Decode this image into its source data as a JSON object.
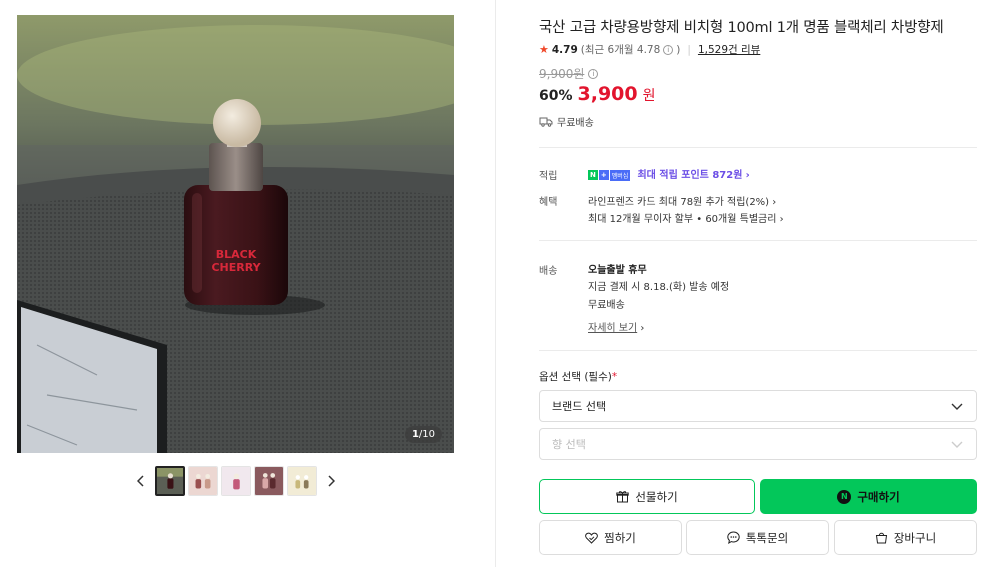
{
  "gallery": {
    "counter_current": "1",
    "counter_total": "/10",
    "prev_arrow": "‹",
    "next_arrow": "›",
    "thumbnails": [
      "thumb-1",
      "thumb-2",
      "thumb-3",
      "thumb-4",
      "thumb-5"
    ],
    "bottle_label_line1": "BLACK",
    "bottle_label_line2": "CHERRY"
  },
  "product": {
    "title": "국산 고급 차량용방향제 비치형 100ml 1개 명품 블랙체리 차방향제",
    "rating": {
      "star": "★",
      "score": "4.79",
      "recent_prefix": "(최근 6개월 4.78",
      "recent_suffix": ")",
      "reviews": "1,529건 리뷰"
    },
    "original_price": "9,900원",
    "discount": "60%",
    "price": "3,900",
    "currency": "원",
    "shipping_badge": "무료배송"
  },
  "benefits": {
    "points_label": "적립",
    "npay_n": "N",
    "npay_plus": "+",
    "npay_membership": "멤버십",
    "points_text": "최대 적립 포인트 872원",
    "benefit_label": "혜택",
    "benefit_line1": "라인프렌즈 카드 최대 78원 추가 적립(2%)",
    "benefit_line2": "최대 12개월 무이자 할부 • 60개월 특별금리"
  },
  "delivery": {
    "label": "배송",
    "status": "오늘출발 휴무",
    "schedule": "지금 결제 시 8.18.(화) 발송 예정",
    "fee": "무료배송",
    "detail_link": "자세히 보기"
  },
  "options": {
    "label": "옵션 선택 (필수)",
    "required_mark": "*",
    "select1": "브랜드 선택",
    "select2": "향 선택"
  },
  "actions": {
    "gift": "선물하기",
    "buy": "구매하기",
    "buy_badge": "N",
    "wish": "찜하기",
    "talk": "톡톡문의",
    "cart": "장바구니"
  },
  "colors": {
    "accent_green": "#03c75a",
    "price_red": "#e2142d",
    "points_purple": "#6b4ee6"
  }
}
